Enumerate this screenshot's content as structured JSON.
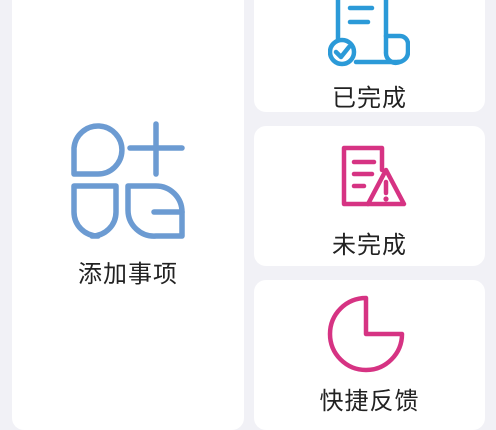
{
  "tiles": {
    "add": {
      "label": "添加事项",
      "icon": "add-items-icon",
      "color": "#6c9bd2"
    },
    "done": {
      "label": "已完成",
      "icon": "completed-document-icon",
      "color": "#2b9ad8"
    },
    "undone": {
      "label": "未完成",
      "icon": "warning-document-icon",
      "color": "#d63383"
    },
    "feedback": {
      "label": "快捷反馈",
      "icon": "pie-chart-icon",
      "color": "#d63383"
    }
  }
}
